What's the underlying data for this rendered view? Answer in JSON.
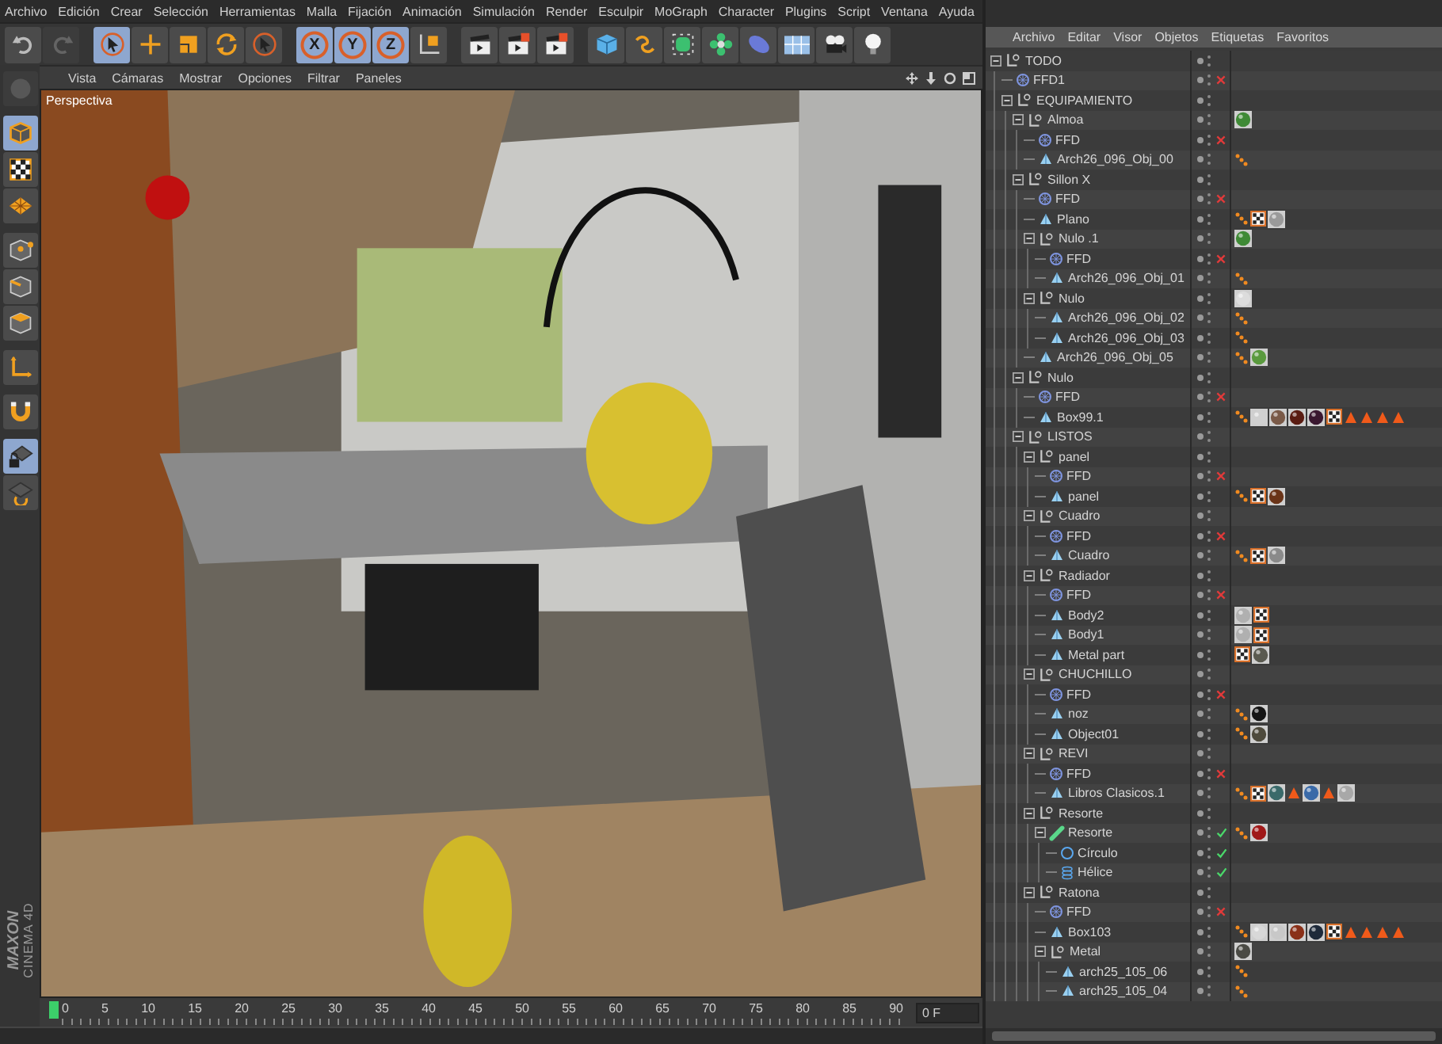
{
  "menu_bar": [
    "Archivo",
    "Edición",
    "Crear",
    "Selección",
    "Herramientas",
    "Malla",
    "Fijación",
    "Animación",
    "Simulación",
    "Render",
    "Esculpir",
    "MoGraph",
    "Character",
    "Plugins",
    "Script",
    "Ventana",
    "Ayuda"
  ],
  "toolbar_groups": [
    {
      "items": [
        {
          "kind": "undo",
          "selected": false,
          "disabled": false
        },
        {
          "kind": "redo",
          "selected": false,
          "disabled": true
        }
      ]
    },
    {
      "items": [
        {
          "kind": "select",
          "selected": true,
          "disabled": false
        },
        {
          "kind": "move",
          "selected": false,
          "disabled": false
        },
        {
          "kind": "scale",
          "selected": false,
          "disabled": false
        },
        {
          "kind": "rotate",
          "selected": false,
          "disabled": false
        },
        {
          "kind": "live-select",
          "selected": false,
          "disabled": false
        }
      ]
    },
    {
      "items": [
        {
          "kind": "axis-lock",
          "label": "X",
          "selected": true,
          "disabled": false
        },
        {
          "kind": "axis-lock",
          "label": "Y",
          "selected": true,
          "disabled": false
        },
        {
          "kind": "axis-lock",
          "label": "Z",
          "selected": true,
          "disabled": false
        },
        {
          "kind": "world",
          "selected": false,
          "disabled": false
        }
      ]
    },
    {
      "items": [
        {
          "kind": "render-view",
          "selected": false,
          "disabled": false
        },
        {
          "kind": "render-picture",
          "selected": false,
          "disabled": false
        },
        {
          "kind": "render-settings",
          "selected": false,
          "disabled": false
        }
      ]
    },
    {
      "items": [
        {
          "kind": "cube",
          "selected": false,
          "disabled": false
        },
        {
          "kind": "spline",
          "selected": false,
          "disabled": false
        },
        {
          "kind": "subdivision",
          "selected": false,
          "disabled": false
        },
        {
          "kind": "cloner",
          "selected": false,
          "disabled": false
        },
        {
          "kind": "deformer",
          "selected": false,
          "disabled": false
        },
        {
          "kind": "floor",
          "selected": false,
          "disabled": false
        },
        {
          "kind": "camera",
          "selected": false,
          "disabled": false
        },
        {
          "kind": "light",
          "selected": false,
          "disabled": false
        }
      ]
    }
  ],
  "left_tool_groups": [
    {
      "items": [
        {
          "kind": "brush",
          "selected": false,
          "disabled": true
        }
      ]
    },
    {
      "items": [
        {
          "kind": "model",
          "selected": true,
          "disabled": false
        },
        {
          "kind": "texture",
          "selected": false,
          "disabled": false
        },
        {
          "kind": "workplane",
          "selected": false,
          "disabled": false
        }
      ]
    },
    {
      "items": [
        {
          "kind": "points",
          "selected": false,
          "disabled": false
        },
        {
          "kind": "edges",
          "selected": false,
          "disabled": false
        },
        {
          "kind": "polygons",
          "selected": false,
          "disabled": false
        }
      ]
    },
    {
      "items": [
        {
          "kind": "axis",
          "selected": false,
          "disabled": false
        }
      ]
    },
    {
      "items": [
        {
          "kind": "magnet",
          "selected": false,
          "disabled": false
        }
      ]
    },
    {
      "items": [
        {
          "kind": "lock-workplane",
          "selected": true,
          "disabled": false
        },
        {
          "kind": "rotate-workplane",
          "selected": false,
          "disabled": false
        }
      ]
    }
  ],
  "logo": {
    "brand": "MAXON",
    "product": "CINEMA 4D"
  },
  "viewport": {
    "menu": [
      "Vista",
      "Cámaras",
      "Mostrar",
      "Opciones",
      "Filtrar",
      "Paneles"
    ],
    "camera_label": "Perspectiva",
    "view": {
      "kind": "picture"
    }
  },
  "timeline": {
    "ticks": [
      "0",
      "5",
      "10",
      "15",
      "20",
      "25",
      "30",
      "35",
      "40",
      "45",
      "50",
      "55",
      "60",
      "65",
      "70",
      "75",
      "80",
      "85",
      "90"
    ],
    "level": 0,
    "frame": "0 F"
  },
  "object_manager": {
    "menu": [
      "Archivo",
      "Editar",
      "Visor",
      "Objetos",
      "Etiquetas",
      "Favoritos"
    ],
    "tree": [
      {
        "name": "TODO",
        "kind": "null",
        "expanded": true,
        "children": [
          {
            "name": "FFD1",
            "kind": "ffd",
            "enabled": false
          },
          {
            "name": "EQUIPAMIENTO",
            "kind": "null",
            "expanded": true,
            "children": [
              {
                "name": "Almoa",
                "kind": "null",
                "expanded": true,
                "tags": [
                  {
                    "kind": "material",
                    "color": "#3f8a36"
                  }
                ],
                "children": [
                  {
                    "name": "FFD",
                    "kind": "ffd",
                    "enabled": false
                  },
                  {
                    "name": "Arch26_096_Obj_00",
                    "kind": "poly",
                    "tags": [
                      {
                        "kind": "points"
                      }
                    ]
                  }
                ]
              },
              {
                "name": "Sillon X",
                "kind": "null",
                "expanded": true,
                "children": [
                  {
                    "name": "FFD",
                    "kind": "ffd",
                    "enabled": false
                  },
                  {
                    "name": "Plano",
                    "kind": "poly",
                    "tags": [
                      {
                        "kind": "points"
                      },
                      {
                        "kind": "checker"
                      },
                      {
                        "kind": "material",
                        "color": "#9a9a9a"
                      }
                    ]
                  },
                  {
                    "name": "Nulo .1",
                    "kind": "null",
                    "expanded": true,
                    "tags": [
                      {
                        "kind": "material",
                        "color": "#3f8a36"
                      }
                    ],
                    "children": [
                      {
                        "name": "FFD",
                        "kind": "ffd",
                        "enabled": false
                      },
                      {
                        "name": "Arch26_096_Obj_01",
                        "kind": "poly",
                        "tags": [
                          {
                            "kind": "points"
                          }
                        ]
                      }
                    ]
                  },
                  {
                    "name": "Nulo",
                    "kind": "null",
                    "expanded": true,
                    "tags": [
                      {
                        "kind": "material",
                        "color": "#dcdcdc"
                      }
                    ],
                    "children": [
                      {
                        "name": "Arch26_096_Obj_02",
                        "kind": "poly",
                        "tags": [
                          {
                            "kind": "points"
                          }
                        ]
                      },
                      {
                        "name": "Arch26_096_Obj_03",
                        "kind": "poly",
                        "tags": [
                          {
                            "kind": "points"
                          }
                        ]
                      }
                    ]
                  },
                  {
                    "name": "Arch26_096_Obj_05",
                    "kind": "poly",
                    "tags": [
                      {
                        "kind": "points"
                      },
                      {
                        "kind": "material",
                        "color": "#5a9a3e"
                      }
                    ]
                  }
                ]
              },
              {
                "name": "Nulo",
                "kind": "null",
                "expanded": true,
                "children": [
                  {
                    "name": "FFD",
                    "kind": "ffd",
                    "enabled": false
                  },
                  {
                    "name": "Box99.1",
                    "kind": "poly",
                    "tags": [
                      {
                        "kind": "points"
                      },
                      {
                        "kind": "material",
                        "color": "#d0d0d0"
                      },
                      {
                        "kind": "material",
                        "color": "#7a5a48"
                      },
                      {
                        "kind": "material",
                        "color": "#5a1c12"
                      },
                      {
                        "kind": "material",
                        "color": "#3a1830"
                      },
                      {
                        "kind": "checker"
                      },
                      {
                        "kind": "cone"
                      },
                      {
                        "kind": "cone"
                      },
                      {
                        "kind": "cone"
                      },
                      {
                        "kind": "cone"
                      }
                    ]
                  }
                ]
              },
              {
                "name": "LISTOS",
                "kind": "null",
                "expanded": true,
                "children": [
                  {
                    "name": "panel",
                    "kind": "null",
                    "expanded": true,
                    "children": [
                      {
                        "name": "FFD",
                        "kind": "ffd",
                        "enabled": false
                      },
                      {
                        "name": "panel",
                        "kind": "poly",
                        "tags": [
                          {
                            "kind": "points"
                          },
                          {
                            "kind": "checker"
                          },
                          {
                            "kind": "material",
                            "color": "#6a3418"
                          }
                        ]
                      }
                    ]
                  },
                  {
                    "name": "Cuadro",
                    "kind": "null",
                    "expanded": true,
                    "children": [
                      {
                        "name": "FFD",
                        "kind": "ffd",
                        "enabled": false
                      },
                      {
                        "name": "Cuadro",
                        "kind": "poly",
                        "tags": [
                          {
                            "kind": "points"
                          },
                          {
                            "kind": "checker"
                          },
                          {
                            "kind": "material",
                            "color": "#8a8a8a"
                          }
                        ]
                      }
                    ]
                  },
                  {
                    "name": "Radiador",
                    "kind": "null",
                    "expanded": true,
                    "children": [
                      {
                        "name": "FFD",
                        "kind": "ffd",
                        "enabled": false
                      },
                      {
                        "name": "Body2",
                        "kind": "poly",
                        "tags": [
                          {
                            "kind": "material",
                            "color": "#b0b0b0"
                          },
                          {
                            "kind": "checker"
                          }
                        ]
                      },
                      {
                        "name": "Body1",
                        "kind": "poly",
                        "tags": [
                          {
                            "kind": "material",
                            "color": "#b0b0b0"
                          },
                          {
                            "kind": "checker"
                          }
                        ]
                      },
                      {
                        "name": "Metal part",
                        "kind": "poly",
                        "tags": [
                          {
                            "kind": "checker"
                          },
                          {
                            "kind": "material",
                            "color": "#5a5a50"
                          }
                        ]
                      }
                    ]
                  },
                  {
                    "name": "CHUCHILLO",
                    "kind": "null",
                    "expanded": true,
                    "children": [
                      {
                        "name": "FFD",
                        "kind": "ffd",
                        "enabled": false
                      },
                      {
                        "name": "noz",
                        "kind": "poly",
                        "tags": [
                          {
                            "kind": "points"
                          },
                          {
                            "kind": "material",
                            "color": "#151515"
                          }
                        ]
                      },
                      {
                        "name": "Object01",
                        "kind": "poly",
                        "tags": [
                          {
                            "kind": "points"
                          },
                          {
                            "kind": "material",
                            "color": "#4e4a3c"
                          }
                        ]
                      }
                    ]
                  },
                  {
                    "name": "REVI",
                    "kind": "null",
                    "expanded": true,
                    "children": [
                      {
                        "name": "FFD",
                        "kind": "ffd",
                        "enabled": false
                      },
                      {
                        "name": "Libros Clasicos.1",
                        "kind": "poly",
                        "tags": [
                          {
                            "kind": "points"
                          },
                          {
                            "kind": "checker"
                          },
                          {
                            "kind": "material",
                            "color": "#3a6a6a"
                          },
                          {
                            "kind": "cone"
                          },
                          {
                            "kind": "material",
                            "color": "#3a6aa8"
                          },
                          {
                            "kind": "cone"
                          },
                          {
                            "kind": "material",
                            "color": "#a8a8a8"
                          }
                        ]
                      }
                    ]
                  },
                  {
                    "name": "Resorte",
                    "kind": "null",
                    "expanded": true,
                    "children": [
                      {
                        "name": "Resorte",
                        "kind": "spring",
                        "enabled": true,
                        "expanded": true,
                        "tags": [
                          {
                            "kind": "points"
                          },
                          {
                            "kind": "material",
                            "color": "#a01818"
                          }
                        ],
                        "children": [
                          {
                            "name": "Círculo",
                            "kind": "circle",
                            "enabled": true
                          },
                          {
                            "name": "Hélice",
                            "kind": "helix",
                            "enabled": true
                          }
                        ]
                      }
                    ]
                  },
                  {
                    "name": "Ratona",
                    "kind": "null",
                    "expanded": true,
                    "children": [
                      {
                        "name": "FFD",
                        "kind": "ffd",
                        "enabled": false
                      },
                      {
                        "name": "Box103",
                        "kind": "poly",
                        "tags": [
                          {
                            "kind": "points"
                          },
                          {
                            "kind": "material",
                            "color": "#d8d8d8"
                          },
                          {
                            "kind": "material",
                            "color": "#c8c8c8"
                          },
                          {
                            "kind": "material",
                            "color": "#8a3018"
                          },
                          {
                            "kind": "material",
                            "color": "#1e2a3a"
                          },
                          {
                            "kind": "checker"
                          },
                          {
                            "kind": "cone"
                          },
                          {
                            "kind": "cone"
                          },
                          {
                            "kind": "cone"
                          },
                          {
                            "kind": "cone"
                          }
                        ]
                      },
                      {
                        "name": "Metal",
                        "kind": "null",
                        "expanded": true,
                        "tags": [
                          {
                            "kind": "material",
                            "color": "#4a4a44"
                          }
                        ],
                        "children": [
                          {
                            "name": "arch25_105_06",
                            "kind": "poly",
                            "tags": [
                              {
                                "kind": "points"
                              }
                            ]
                          },
                          {
                            "name": "arch25_105_04",
                            "kind": "poly",
                            "tags": [
                              {
                                "kind": "points"
                              }
                            ]
                          }
                        ]
                      }
                    ]
                  }
                ]
              }
            ]
          }
        ]
      }
    ]
  }
}
